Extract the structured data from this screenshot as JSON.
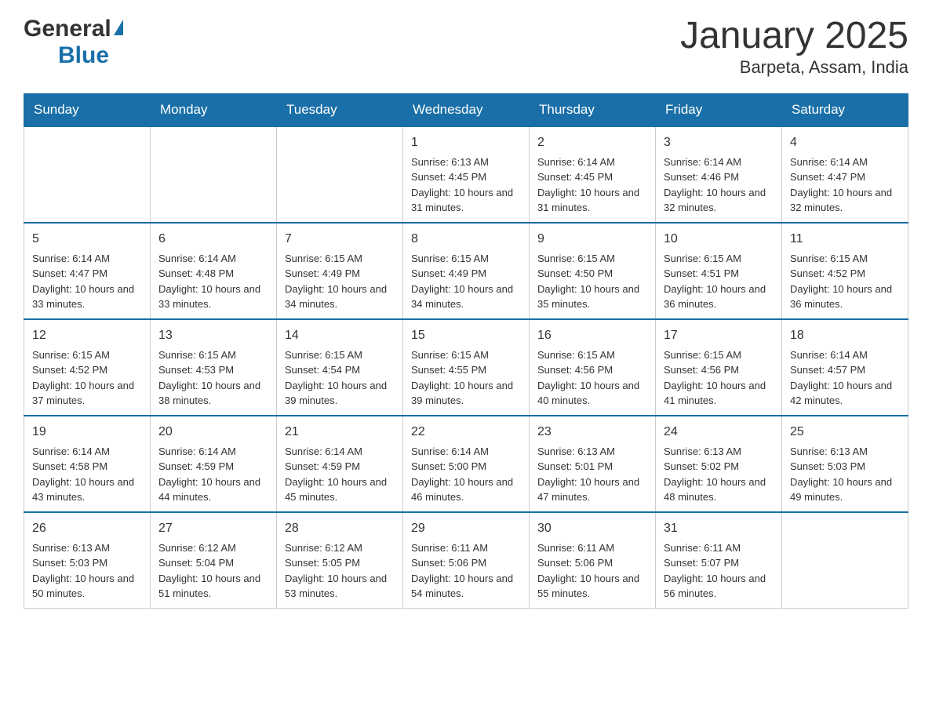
{
  "header": {
    "logo_general": "General",
    "logo_blue": "Blue",
    "month_title": "January 2025",
    "location": "Barpeta, Assam, India"
  },
  "days_of_week": [
    "Sunday",
    "Monday",
    "Tuesday",
    "Wednesday",
    "Thursday",
    "Friday",
    "Saturday"
  ],
  "weeks": [
    [
      {
        "day": "",
        "info": ""
      },
      {
        "day": "",
        "info": ""
      },
      {
        "day": "",
        "info": ""
      },
      {
        "day": "1",
        "info": "Sunrise: 6:13 AM\nSunset: 4:45 PM\nDaylight: 10 hours and 31 minutes."
      },
      {
        "day": "2",
        "info": "Sunrise: 6:14 AM\nSunset: 4:45 PM\nDaylight: 10 hours and 31 minutes."
      },
      {
        "day": "3",
        "info": "Sunrise: 6:14 AM\nSunset: 4:46 PM\nDaylight: 10 hours and 32 minutes."
      },
      {
        "day": "4",
        "info": "Sunrise: 6:14 AM\nSunset: 4:47 PM\nDaylight: 10 hours and 32 minutes."
      }
    ],
    [
      {
        "day": "5",
        "info": "Sunrise: 6:14 AM\nSunset: 4:47 PM\nDaylight: 10 hours and 33 minutes."
      },
      {
        "day": "6",
        "info": "Sunrise: 6:14 AM\nSunset: 4:48 PM\nDaylight: 10 hours and 33 minutes."
      },
      {
        "day": "7",
        "info": "Sunrise: 6:15 AM\nSunset: 4:49 PM\nDaylight: 10 hours and 34 minutes."
      },
      {
        "day": "8",
        "info": "Sunrise: 6:15 AM\nSunset: 4:49 PM\nDaylight: 10 hours and 34 minutes."
      },
      {
        "day": "9",
        "info": "Sunrise: 6:15 AM\nSunset: 4:50 PM\nDaylight: 10 hours and 35 minutes."
      },
      {
        "day": "10",
        "info": "Sunrise: 6:15 AM\nSunset: 4:51 PM\nDaylight: 10 hours and 36 minutes."
      },
      {
        "day": "11",
        "info": "Sunrise: 6:15 AM\nSunset: 4:52 PM\nDaylight: 10 hours and 36 minutes."
      }
    ],
    [
      {
        "day": "12",
        "info": "Sunrise: 6:15 AM\nSunset: 4:52 PM\nDaylight: 10 hours and 37 minutes."
      },
      {
        "day": "13",
        "info": "Sunrise: 6:15 AM\nSunset: 4:53 PM\nDaylight: 10 hours and 38 minutes."
      },
      {
        "day": "14",
        "info": "Sunrise: 6:15 AM\nSunset: 4:54 PM\nDaylight: 10 hours and 39 minutes."
      },
      {
        "day": "15",
        "info": "Sunrise: 6:15 AM\nSunset: 4:55 PM\nDaylight: 10 hours and 39 minutes."
      },
      {
        "day": "16",
        "info": "Sunrise: 6:15 AM\nSunset: 4:56 PM\nDaylight: 10 hours and 40 minutes."
      },
      {
        "day": "17",
        "info": "Sunrise: 6:15 AM\nSunset: 4:56 PM\nDaylight: 10 hours and 41 minutes."
      },
      {
        "day": "18",
        "info": "Sunrise: 6:14 AM\nSunset: 4:57 PM\nDaylight: 10 hours and 42 minutes."
      }
    ],
    [
      {
        "day": "19",
        "info": "Sunrise: 6:14 AM\nSunset: 4:58 PM\nDaylight: 10 hours and 43 minutes."
      },
      {
        "day": "20",
        "info": "Sunrise: 6:14 AM\nSunset: 4:59 PM\nDaylight: 10 hours and 44 minutes."
      },
      {
        "day": "21",
        "info": "Sunrise: 6:14 AM\nSunset: 4:59 PM\nDaylight: 10 hours and 45 minutes."
      },
      {
        "day": "22",
        "info": "Sunrise: 6:14 AM\nSunset: 5:00 PM\nDaylight: 10 hours and 46 minutes."
      },
      {
        "day": "23",
        "info": "Sunrise: 6:13 AM\nSunset: 5:01 PM\nDaylight: 10 hours and 47 minutes."
      },
      {
        "day": "24",
        "info": "Sunrise: 6:13 AM\nSunset: 5:02 PM\nDaylight: 10 hours and 48 minutes."
      },
      {
        "day": "25",
        "info": "Sunrise: 6:13 AM\nSunset: 5:03 PM\nDaylight: 10 hours and 49 minutes."
      }
    ],
    [
      {
        "day": "26",
        "info": "Sunrise: 6:13 AM\nSunset: 5:03 PM\nDaylight: 10 hours and 50 minutes."
      },
      {
        "day": "27",
        "info": "Sunrise: 6:12 AM\nSunset: 5:04 PM\nDaylight: 10 hours and 51 minutes."
      },
      {
        "day": "28",
        "info": "Sunrise: 6:12 AM\nSunset: 5:05 PM\nDaylight: 10 hours and 53 minutes."
      },
      {
        "day": "29",
        "info": "Sunrise: 6:11 AM\nSunset: 5:06 PM\nDaylight: 10 hours and 54 minutes."
      },
      {
        "day": "30",
        "info": "Sunrise: 6:11 AM\nSunset: 5:06 PM\nDaylight: 10 hours and 55 minutes."
      },
      {
        "day": "31",
        "info": "Sunrise: 6:11 AM\nSunset: 5:07 PM\nDaylight: 10 hours and 56 minutes."
      },
      {
        "day": "",
        "info": ""
      }
    ]
  ]
}
